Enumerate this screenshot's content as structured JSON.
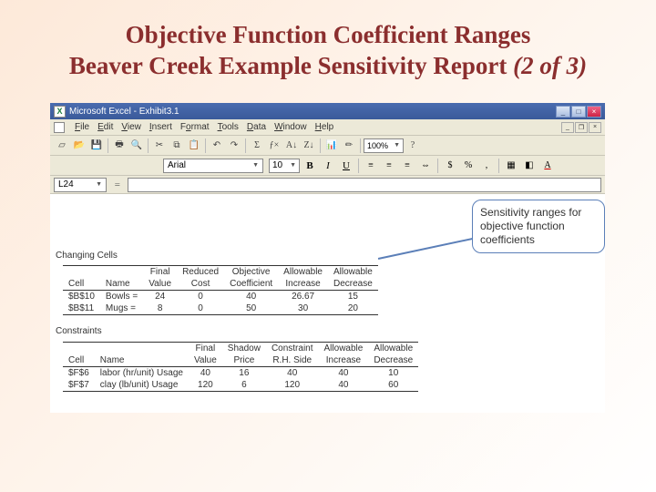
{
  "slide": {
    "title_line1": "Objective Function Coefficient Ranges",
    "title_line2_a": "Beaver Creek Example Sensitivity Report ",
    "title_line2_b": "(2 of 3)"
  },
  "titlebar": {
    "app": "Microsoft Excel",
    "doc": "Exhibit3.1"
  },
  "menubar": {
    "items": [
      "File",
      "Edit",
      "View",
      "Insert",
      "Format",
      "Tools",
      "Data",
      "Window",
      "Help"
    ]
  },
  "toolbar": {
    "zoom": "100%"
  },
  "formatbar": {
    "font": "Arial",
    "size": "10"
  },
  "namebox": {
    "cell": "L24",
    "formula": "="
  },
  "callout": "Sensitivity ranges for objective function coefficients",
  "changing": {
    "label": "Changing Cells",
    "headers_top": [
      "",
      "",
      "Final",
      "Reduced",
      "Objective",
      "Allowable",
      "Allowable"
    ],
    "headers_bot": [
      "Cell",
      "Name",
      "Value",
      "Cost",
      "Coefficient",
      "Increase",
      "Decrease"
    ],
    "rows": [
      {
        "cell": "$B$10",
        "name": "Bowls =",
        "final": "24",
        "reduced": "0",
        "obj": "40",
        "inc": "26.67",
        "dec": "15"
      },
      {
        "cell": "$B$11",
        "name": "Mugs =",
        "final": "8",
        "reduced": "0",
        "obj": "50",
        "inc": "30",
        "dec": "20"
      }
    ]
  },
  "constraints": {
    "label": "Constraints",
    "headers_top": [
      "",
      "",
      "Final",
      "Shadow",
      "Constraint",
      "Allowable",
      "Allowable"
    ],
    "headers_bot": [
      "Cell",
      "Name",
      "Value",
      "Price",
      "R.H. Side",
      "Increase",
      "Decrease"
    ],
    "rows": [
      {
        "cell": "$F$6",
        "name": "labor (hr/unit) Usage",
        "final": "40",
        "shadow": "16",
        "rhs": "40",
        "inc": "40",
        "dec": "10"
      },
      {
        "cell": "$F$7",
        "name": "clay (lb/unit) Usage",
        "final": "120",
        "shadow": "6",
        "rhs": "120",
        "inc": "40",
        "dec": "60"
      }
    ]
  }
}
